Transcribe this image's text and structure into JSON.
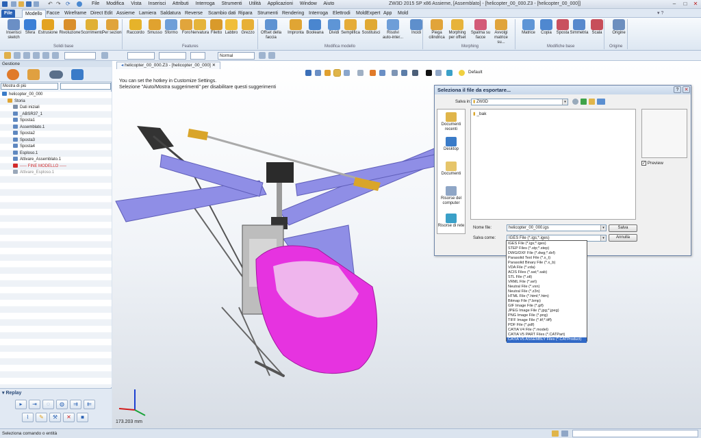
{
  "titlebar": {
    "menu": [
      "File",
      "Modifica",
      "Vista",
      "Inserisci",
      "Attributi",
      "Interroga",
      "Strumenti",
      "Utilità",
      "Applicazioni",
      "Window",
      "Aiuto"
    ],
    "title": "ZW3D 2015 SP x86          Assieme, [Assemblato] - [helicopter_00_000.Z3 - [helicopter_00_000]]"
  },
  "ribbon_tabs": [
    "File",
    "Modello",
    "Facce",
    "Wireframe",
    "Direct Edit",
    "Assieme",
    "Lamiera",
    "Saldatura",
    "Reverse",
    "Scambio dati",
    "Ripara",
    "Strumenti",
    "Rendering",
    "Interroga",
    "Elettrodi",
    "MoldExpert",
    "App",
    "Mold"
  ],
  "ribbon": {
    "buttons": [
      {
        "label": "Inserisci sketch",
        "color": "#6b8fc5"
      },
      {
        "label": "Sfera",
        "color": "#3b7fd6"
      },
      {
        "label": "Estrusione",
        "color": "#e3a321"
      },
      {
        "label": "Rivoluzione",
        "color": "#d98f2c"
      },
      {
        "label": "Scorrimento",
        "color": "#e0b035"
      },
      {
        "label": "Per sezioni",
        "color": "#e0a43b"
      },
      {
        "label": "Raccordo",
        "color": "#e6b32a"
      },
      {
        "label": "Smusso",
        "color": "#e0a22f"
      },
      {
        "label": "Sformo",
        "color": "#6e9ed8"
      },
      {
        "label": "Foro",
        "color": "#e1a53c"
      },
      {
        "label": "Nervatura",
        "color": "#e5b43a"
      },
      {
        "label": "Filetto",
        "color": "#d99a2b"
      },
      {
        "label": "Labbro",
        "color": "#f0be3a"
      },
      {
        "label": "Grezzo",
        "color": "#e7b037"
      },
      {
        "label": "Offset della faccia",
        "color": "#5f93d2"
      },
      {
        "label": "Impronta",
        "color": "#e0a534"
      },
      {
        "label": "Booleana",
        "color": "#4a86cf"
      },
      {
        "label": "Dividi",
        "color": "#5e95d6"
      },
      {
        "label": "Semplifica",
        "color": "#e5ac38"
      },
      {
        "label": "Sostituisci",
        "color": "#e0a934"
      },
      {
        "label": "Risolvi auto-inter...",
        "color": "#6e9ed8"
      },
      {
        "label": "Incidi",
        "color": "#5e8fcc"
      },
      {
        "label": "Piega cilindrica",
        "color": "#e1a43a"
      },
      {
        "label": "Morphing per offset",
        "color": "#e7b33b"
      },
      {
        "label": "Spalma su facce",
        "color": "#d35b78"
      },
      {
        "label": "Avvolgi matrice su...",
        "color": "#e0a43b"
      },
      {
        "label": "Matrice",
        "color": "#5e95d6"
      },
      {
        "label": "Copia",
        "color": "#4f88d0"
      },
      {
        "label": "Sposta",
        "color": "#c9505f"
      },
      {
        "label": "Simmetria",
        "color": "#5789cd"
      },
      {
        "label": "Scala",
        "color": "#c74e5a"
      },
      {
        "label": "Origine",
        "color": "#6d8fbf"
      }
    ],
    "groups": [
      "Solidi base",
      "Features",
      "Modifica modello",
      "Morphing",
      "Modifiche base",
      "Origine"
    ]
  },
  "toolrow": {
    "mode_combo": "Normal"
  },
  "left_panel": {
    "header": "Gestione",
    "filter": "Mostra di più",
    "tree": [
      {
        "label": "helicopter_00_000",
        "indent": 0,
        "color": "#3a7bc8"
      },
      {
        "label": "Storia",
        "indent": 1,
        "color": "#e0a533"
      },
      {
        "label": "Dati iniziali",
        "indent": 2,
        "color": "#7d8fa8"
      },
      {
        "label": "_ABSR37_1",
        "indent": 2,
        "color": "#5f88c0"
      },
      {
        "label": "Sposta1",
        "indent": 2,
        "color": "#5f88c0"
      },
      {
        "label": "Assemblato.1",
        "indent": 2,
        "color": "#5f88c0"
      },
      {
        "label": "Sposta2",
        "indent": 2,
        "color": "#5f88c0"
      },
      {
        "label": "Sposta3",
        "indent": 2,
        "color": "#5f88c0"
      },
      {
        "label": "Sposta4",
        "indent": 2,
        "color": "#5f88c0"
      },
      {
        "label": "Esploso.1",
        "indent": 2,
        "color": "#5f88c0"
      },
      {
        "label": "Attivare_Assemblato.1",
        "indent": 2,
        "color": "#5f88c0"
      },
      {
        "label": "----- FINE MODELLO -----",
        "indent": 2,
        "color": "#d22b2b",
        "text_color": "#d22b2b"
      },
      {
        "label": "Attivare_Esploso.1",
        "indent": 2,
        "color": "#9aa8ba",
        "text_color": "#8a8a8a"
      }
    ],
    "replay_title": "Replay"
  },
  "viewport": {
    "doc_tab": "helicopter_00_000.Z3 - [helicopter_00_000]",
    "render_mode": "Default",
    "hint_line1": "You can set the hotkey in Customize Settings.",
    "hint_line2": "Selezione \"Aiuto/Mostra suggerimenti\" per disabilitare questi suggerimenti",
    "scale": "173.203 mm"
  },
  "dialog": {
    "title": "Seleziona il file da esportare...",
    "save_in_label": "Salva in:",
    "save_in_value": "ZW3D",
    "places": [
      "Documenti recenti",
      "Desktop",
      "Documenti",
      "Risorse del computer",
      "Risorse di rete"
    ],
    "files": [
      "_bak"
    ],
    "preview_label": "Preview",
    "filename_label": "Nome file:",
    "filename_value": "helicopter_00_000.igs",
    "savetype_label": "Salva come:",
    "savetype_value": "IGES File (*.igs;*.iges)",
    "save_button": "Salva",
    "cancel_button": "Annulla",
    "type_options": [
      "IGES File (*.igs;*.iges)",
      "STEP Files (*.stp;*.step)",
      "DWG/DXF File (*.dwg;*.dxf)",
      "Parasolid Text File (*.x_t)",
      "Parasolid Binary File (*.x_b)",
      "VDA File (*.vda)",
      "ACIS Files (*.sat;*.sab)",
      "STL File (*.stl)",
      "VRML File (*.wrl)",
      "Neutral File (*.vxn)",
      "Neutral File (*.z3n)",
      "HTML File (*.html;*.htm)",
      "Bitmap File (*.bmp)",
      "GIF Image File (*.gif)",
      "JPEG Image File (*.jpg;*.jpeg)",
      "PNG Image File (*.png)",
      "TIFF Image File (*.tif;*.tiff)",
      "PDF File (*.pdf)",
      "CATIA V4 File (*.model)",
      "CATIA V5 PART Files (*.CATPart)",
      "CATIA V5 ASSEMBLY Files (*.CATProduct)"
    ],
    "selected_option": 20
  },
  "statusbar": {
    "text": "Seleziona comando o entità"
  },
  "colors": {
    "accent": "#2a62b5",
    "canopy": "#e633e0",
    "blades": "#8f8ee6",
    "selection": "#3169c6"
  }
}
